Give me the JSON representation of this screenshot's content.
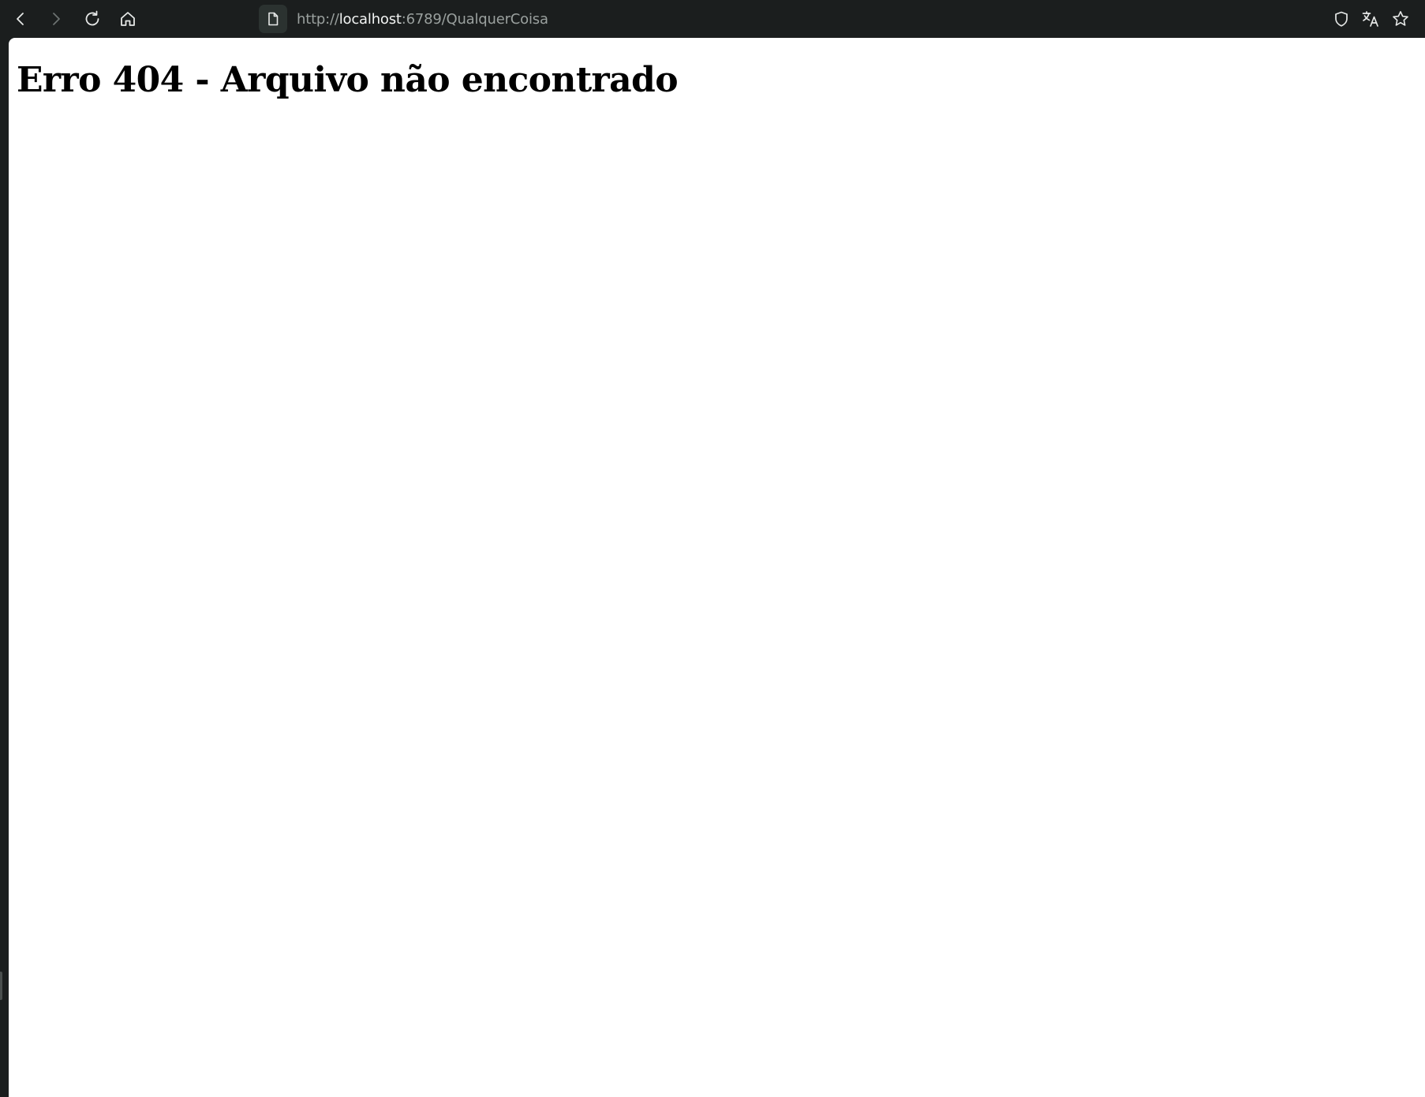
{
  "toolbar": {
    "back_icon": "chevron-left-icon",
    "forward_icon": "chevron-right-icon",
    "reload_icon": "reload-icon",
    "home_icon": "home-icon",
    "page_icon": "document-icon",
    "shield_icon": "shield-icon",
    "translate_icon": "translate-icon",
    "bookmark_icon": "star-icon"
  },
  "address": {
    "scheme": "http://",
    "host": "localhost",
    "rest": ":6789/QualquerCoisa"
  },
  "page": {
    "heading": "Erro 404 - Arquivo não encontrado"
  },
  "colors": {
    "chrome_background": "#1b1e1e",
    "page_background": "#ffffff",
    "url_host": "#f2f4f3",
    "url_dim": "#9aa09e"
  }
}
